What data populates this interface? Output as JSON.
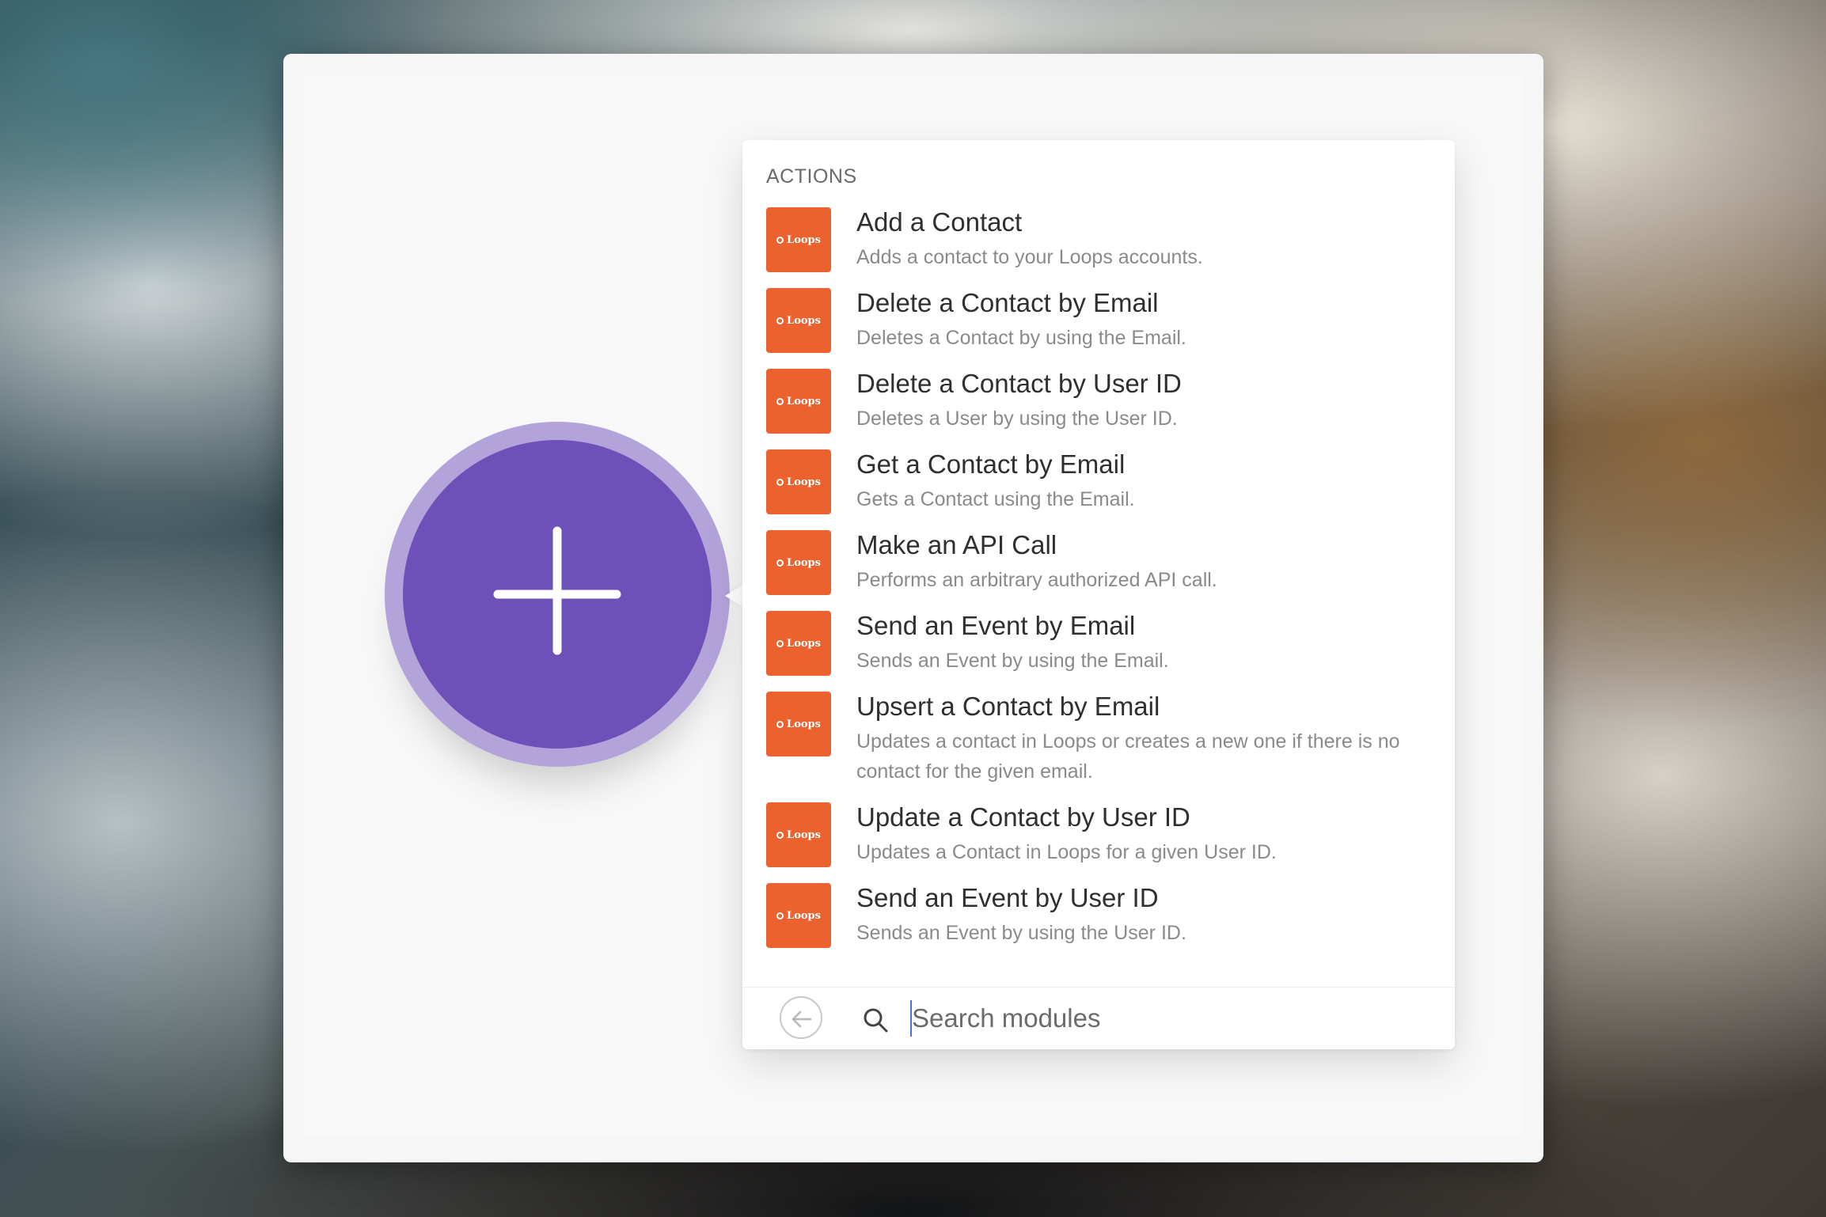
{
  "panel": {
    "section_title": "ACTIONS",
    "actions": [
      {
        "title": "Add a Contact",
        "description": "Adds a contact to your Loops accounts."
      },
      {
        "title": "Delete a Contact by Email",
        "description": "Deletes a Contact by using the Email."
      },
      {
        "title": "Delete a Contact by User ID",
        "description": "Deletes a User by using the User ID."
      },
      {
        "title": "Get a Contact by Email",
        "description": "Gets a Contact using the Email."
      },
      {
        "title": "Make an API Call",
        "description": "Performs an arbitrary authorized API call."
      },
      {
        "title": "Send an Event by Email",
        "description": "Sends an Event by using the Email."
      },
      {
        "title": "Upsert a Contact by Email",
        "description": "Updates a contact in Loops or creates a new one if there is no contact for the given email."
      },
      {
        "title": "Update a Contact by User ID",
        "description": "Updates a Contact in Loops for a given User ID."
      },
      {
        "title": "Send an Event by User ID",
        "description": "Sends an Event by using the User ID."
      }
    ],
    "logo_text": "Loops",
    "search": {
      "placeholder": "Search modules",
      "value": ""
    }
  },
  "icons": {
    "add": "plus-icon",
    "back": "arrow-left-circle-icon",
    "search": "search-icon",
    "app": "loops-logo"
  },
  "colors": {
    "module_purple": "#6d51b8",
    "module_ring": "#b3a3db",
    "loops_orange": "#ec622f"
  }
}
